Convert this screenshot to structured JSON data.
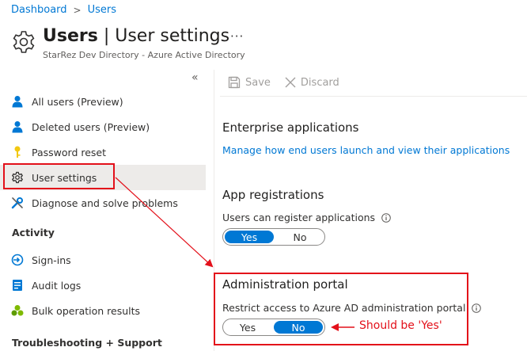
{
  "breadcrumb": {
    "items": [
      "Dashboard",
      "Users"
    ]
  },
  "header": {
    "title_bold": "Users",
    "title_rest": " | User settings",
    "more": "···",
    "subtitle": "StarRez Dev Directory - Azure Active Directory"
  },
  "sidebar": {
    "collapse": "«",
    "items": [
      {
        "label": "All users (Preview)",
        "icon": "user-icon"
      },
      {
        "label": "Deleted users (Preview)",
        "icon": "user-icon"
      },
      {
        "label": "Password reset",
        "icon": "key-icon"
      },
      {
        "label": "User settings",
        "icon": "gear-icon",
        "selected": true
      },
      {
        "label": "Diagnose and solve problems",
        "icon": "wrench-icon"
      }
    ],
    "activity_header": "Activity",
    "activity_items": [
      {
        "label": "Sign-ins",
        "icon": "signin-icon"
      },
      {
        "label": "Audit logs",
        "icon": "audit-log-icon"
      },
      {
        "label": "Bulk operation results",
        "icon": "bulk-operation-icon"
      }
    ],
    "troubleshooting_header": "Troubleshooting + Support"
  },
  "toolbar": {
    "save": "Save",
    "discard": "Discard"
  },
  "content": {
    "enterprise": {
      "title": "Enterprise applications",
      "link": "Manage how end users launch and view their applications"
    },
    "app_registrations": {
      "title": "App registrations",
      "label": "Users can register applications",
      "toggle": {
        "yes": "Yes",
        "no": "No",
        "selected": "Yes"
      }
    },
    "admin_portal": {
      "title": "Administration portal",
      "label": "Restrict access to Azure AD administration portal",
      "toggle": {
        "yes": "Yes",
        "no": "No",
        "selected": "No"
      }
    }
  },
  "annotation": {
    "text": "Should be 'Yes'",
    "color": "#e3101a"
  },
  "colors": {
    "accent": "#0078d4",
    "annotation_red": "#e3101a"
  }
}
